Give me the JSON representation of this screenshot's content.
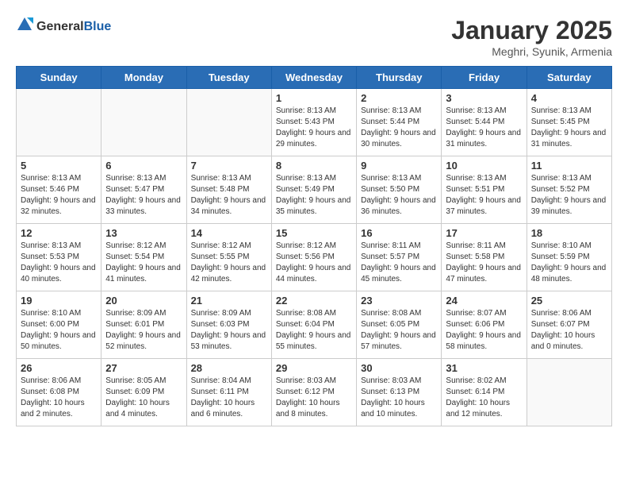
{
  "header": {
    "logo_general": "General",
    "logo_blue": "Blue",
    "month_title": "January 2025",
    "location": "Meghri, Syunik, Armenia"
  },
  "days_of_week": [
    "Sunday",
    "Monday",
    "Tuesday",
    "Wednesday",
    "Thursday",
    "Friday",
    "Saturday"
  ],
  "weeks": [
    [
      {
        "day": "",
        "empty": true
      },
      {
        "day": "",
        "empty": true
      },
      {
        "day": "",
        "empty": true
      },
      {
        "day": "1",
        "sunrise": "8:13 AM",
        "sunset": "5:43 PM",
        "daylight": "9 hours and 29 minutes."
      },
      {
        "day": "2",
        "sunrise": "8:13 AM",
        "sunset": "5:44 PM",
        "daylight": "9 hours and 30 minutes."
      },
      {
        "day": "3",
        "sunrise": "8:13 AM",
        "sunset": "5:44 PM",
        "daylight": "9 hours and 31 minutes."
      },
      {
        "day": "4",
        "sunrise": "8:13 AM",
        "sunset": "5:45 PM",
        "daylight": "9 hours and 31 minutes."
      }
    ],
    [
      {
        "day": "5",
        "sunrise": "8:13 AM",
        "sunset": "5:46 PM",
        "daylight": "9 hours and 32 minutes."
      },
      {
        "day": "6",
        "sunrise": "8:13 AM",
        "sunset": "5:47 PM",
        "daylight": "9 hours and 33 minutes."
      },
      {
        "day": "7",
        "sunrise": "8:13 AM",
        "sunset": "5:48 PM",
        "daylight": "9 hours and 34 minutes."
      },
      {
        "day": "8",
        "sunrise": "8:13 AM",
        "sunset": "5:49 PM",
        "daylight": "9 hours and 35 minutes."
      },
      {
        "day": "9",
        "sunrise": "8:13 AM",
        "sunset": "5:50 PM",
        "daylight": "9 hours and 36 minutes."
      },
      {
        "day": "10",
        "sunrise": "8:13 AM",
        "sunset": "5:51 PM",
        "daylight": "9 hours and 37 minutes."
      },
      {
        "day": "11",
        "sunrise": "8:13 AM",
        "sunset": "5:52 PM",
        "daylight": "9 hours and 39 minutes."
      }
    ],
    [
      {
        "day": "12",
        "sunrise": "8:13 AM",
        "sunset": "5:53 PM",
        "daylight": "9 hours and 40 minutes."
      },
      {
        "day": "13",
        "sunrise": "8:12 AM",
        "sunset": "5:54 PM",
        "daylight": "9 hours and 41 minutes."
      },
      {
        "day": "14",
        "sunrise": "8:12 AM",
        "sunset": "5:55 PM",
        "daylight": "9 hours and 42 minutes."
      },
      {
        "day": "15",
        "sunrise": "8:12 AM",
        "sunset": "5:56 PM",
        "daylight": "9 hours and 44 minutes."
      },
      {
        "day": "16",
        "sunrise": "8:11 AM",
        "sunset": "5:57 PM",
        "daylight": "9 hours and 45 minutes."
      },
      {
        "day": "17",
        "sunrise": "8:11 AM",
        "sunset": "5:58 PM",
        "daylight": "9 hours and 47 minutes."
      },
      {
        "day": "18",
        "sunrise": "8:10 AM",
        "sunset": "5:59 PM",
        "daylight": "9 hours and 48 minutes."
      }
    ],
    [
      {
        "day": "19",
        "sunrise": "8:10 AM",
        "sunset": "6:00 PM",
        "daylight": "9 hours and 50 minutes."
      },
      {
        "day": "20",
        "sunrise": "8:09 AM",
        "sunset": "6:01 PM",
        "daylight": "9 hours and 52 minutes."
      },
      {
        "day": "21",
        "sunrise": "8:09 AM",
        "sunset": "6:03 PM",
        "daylight": "9 hours and 53 minutes."
      },
      {
        "day": "22",
        "sunrise": "8:08 AM",
        "sunset": "6:04 PM",
        "daylight": "9 hours and 55 minutes."
      },
      {
        "day": "23",
        "sunrise": "8:08 AM",
        "sunset": "6:05 PM",
        "daylight": "9 hours and 57 minutes."
      },
      {
        "day": "24",
        "sunrise": "8:07 AM",
        "sunset": "6:06 PM",
        "daylight": "9 hours and 58 minutes."
      },
      {
        "day": "25",
        "sunrise": "8:06 AM",
        "sunset": "6:07 PM",
        "daylight": "10 hours and 0 minutes."
      }
    ],
    [
      {
        "day": "26",
        "sunrise": "8:06 AM",
        "sunset": "6:08 PM",
        "daylight": "10 hours and 2 minutes."
      },
      {
        "day": "27",
        "sunrise": "8:05 AM",
        "sunset": "6:09 PM",
        "daylight": "10 hours and 4 minutes."
      },
      {
        "day": "28",
        "sunrise": "8:04 AM",
        "sunset": "6:11 PM",
        "daylight": "10 hours and 6 minutes."
      },
      {
        "day": "29",
        "sunrise": "8:03 AM",
        "sunset": "6:12 PM",
        "daylight": "10 hours and 8 minutes."
      },
      {
        "day": "30",
        "sunrise": "8:03 AM",
        "sunset": "6:13 PM",
        "daylight": "10 hours and 10 minutes."
      },
      {
        "day": "31",
        "sunrise": "8:02 AM",
        "sunset": "6:14 PM",
        "daylight": "10 hours and 12 minutes."
      },
      {
        "day": "",
        "empty": true
      }
    ]
  ]
}
